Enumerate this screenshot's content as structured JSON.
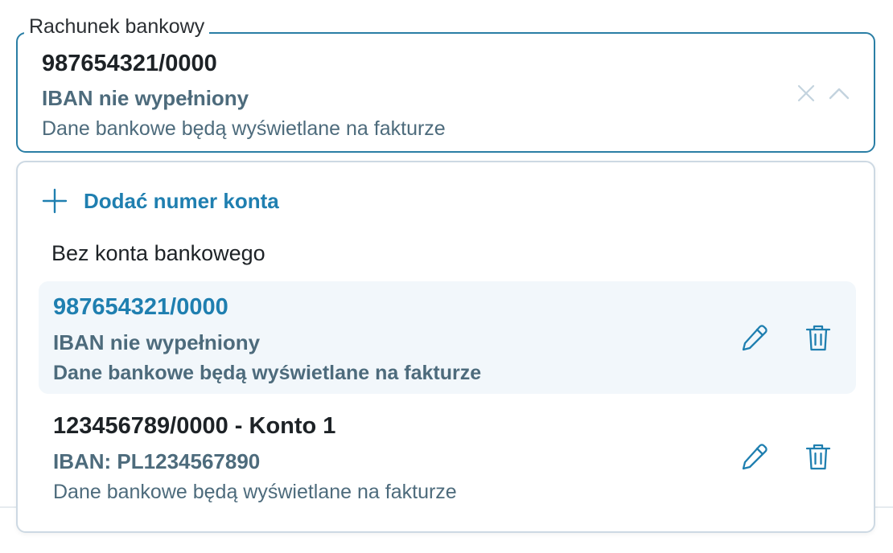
{
  "field": {
    "label": "Rachunek bankowy",
    "selected": {
      "account": "987654321/0000",
      "iban": "IBAN nie wypełniony",
      "info": "Dane bankowe będą wyświetlane na fakturze"
    }
  },
  "dropdown": {
    "add_label": "Dodać numer konta",
    "no_account_label": "Bez konta bankowego",
    "options": [
      {
        "account": "987654321/0000",
        "iban": "IBAN nie wypełniony",
        "info": "Dane bankowe będą wyświetlane na fakturze",
        "selected": true
      },
      {
        "account": "123456789/0000 - Konto 1",
        "iban": "IBAN: PL1234567890",
        "info": "Dane bankowe będą wyświetlane na fakturze",
        "selected": false
      }
    ]
  },
  "icons": {
    "clear": "close-icon",
    "toggle": "chevron-up-icon",
    "add": "plus-icon",
    "edit": "pencil-icon",
    "delete": "trash-icon"
  },
  "colors": {
    "accent": "#1f7fb0",
    "field_border": "#2a7ea5",
    "muted_text": "#4d6b7c",
    "selected_bg": "#f2f7fb",
    "dropdown_border": "#cdd9e3"
  }
}
